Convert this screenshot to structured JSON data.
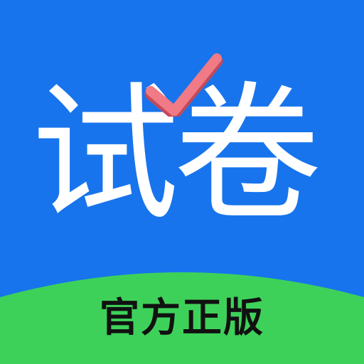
{
  "app_icon": {
    "title": "试卷",
    "tagline": "官方正版",
    "icons": {
      "checkmark": "checkmark-icon"
    }
  },
  "colors": {
    "background": "#1774ec",
    "band": "#3ed15a",
    "checkmark_fill": "#f07a86",
    "checkmark_shadow": "#c24a5a",
    "title_text": "#ffffff",
    "tagline_text": "#111111"
  }
}
